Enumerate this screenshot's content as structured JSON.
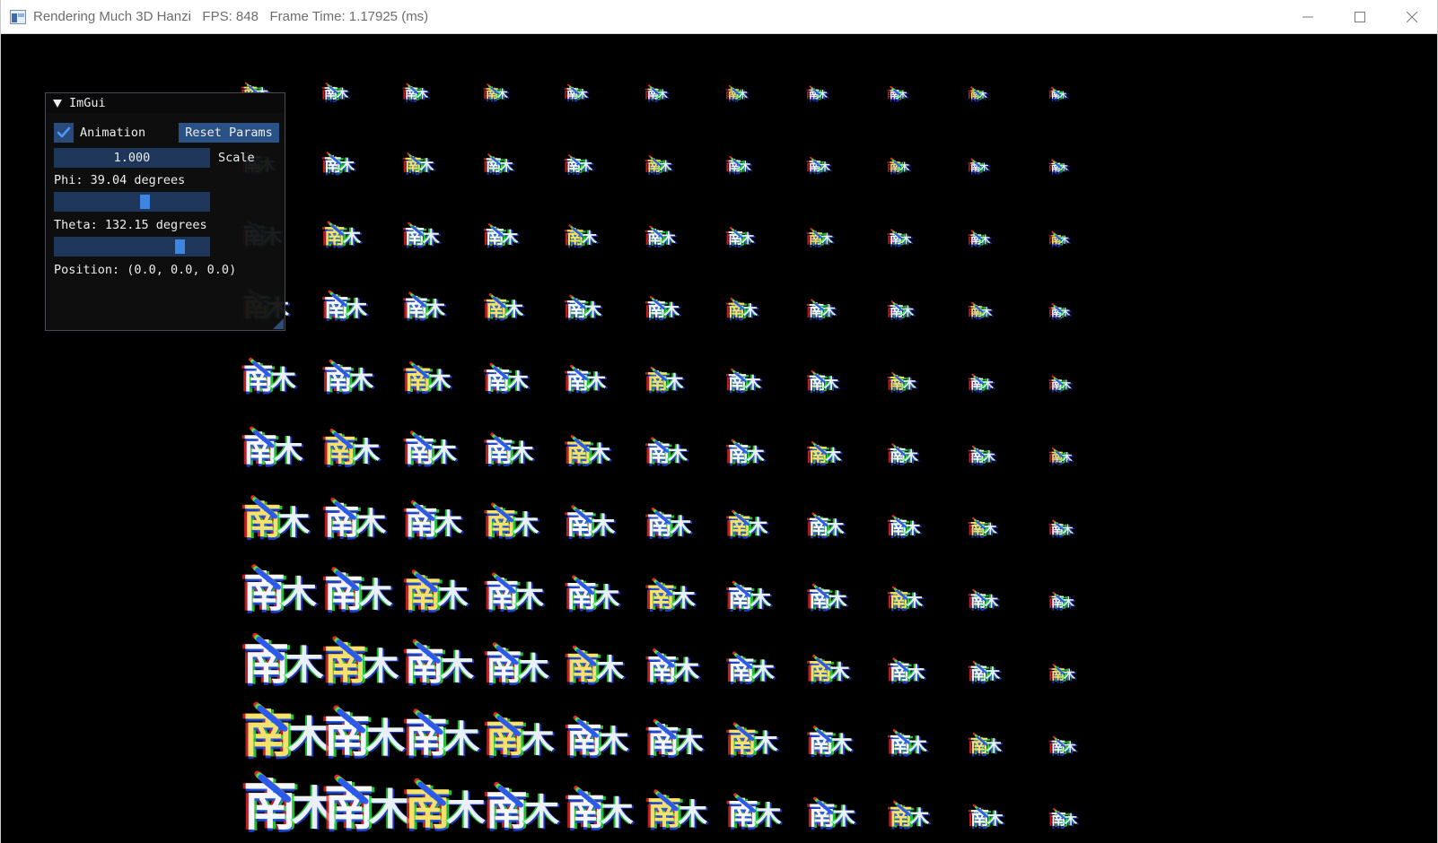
{
  "window": {
    "title": "Rendering Much 3D Hanzi   FPS: 848   Frame Time: 1.17925 (ms)",
    "controls": [
      "minimize-icon",
      "maximize-icon",
      "close-icon"
    ]
  },
  "scene": {
    "glyph": "南",
    "glyph2": "木",
    "colors": [
      "#ff2a2a",
      "#2aff4a",
      "#2a4aff",
      "#ffffff",
      "#ffe86a"
    ]
  },
  "imgui": {
    "title": "ImGui",
    "animation_label": "Animation",
    "animation_checked": true,
    "reset_label": "Reset Params",
    "scale_value": "1.000",
    "scale_label": "Scale",
    "phi_label": "Phi: 39.04 degrees",
    "phi_fraction": 0.59,
    "theta_label": "Theta: 132.15 degrees",
    "theta_fraction": 0.83,
    "position_label": "Position: (0.0, 0.0, 0.0)"
  }
}
